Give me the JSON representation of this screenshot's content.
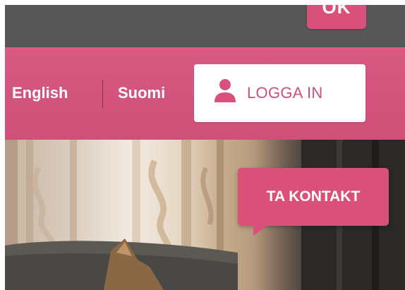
{
  "top_bar": {
    "ok_button_label": "OK"
  },
  "nav": {
    "languages": [
      "English",
      "Suomi"
    ],
    "login_button": {
      "icon": "user-icon",
      "label": "LOGGA IN"
    }
  },
  "hero": {
    "contact_button_label": "TA KONTAKT"
  },
  "colors": {
    "accent_pink": "#d9507a",
    "nav_pink": "#d45780",
    "dark_bar": "#575757",
    "white": "#ffffff"
  }
}
